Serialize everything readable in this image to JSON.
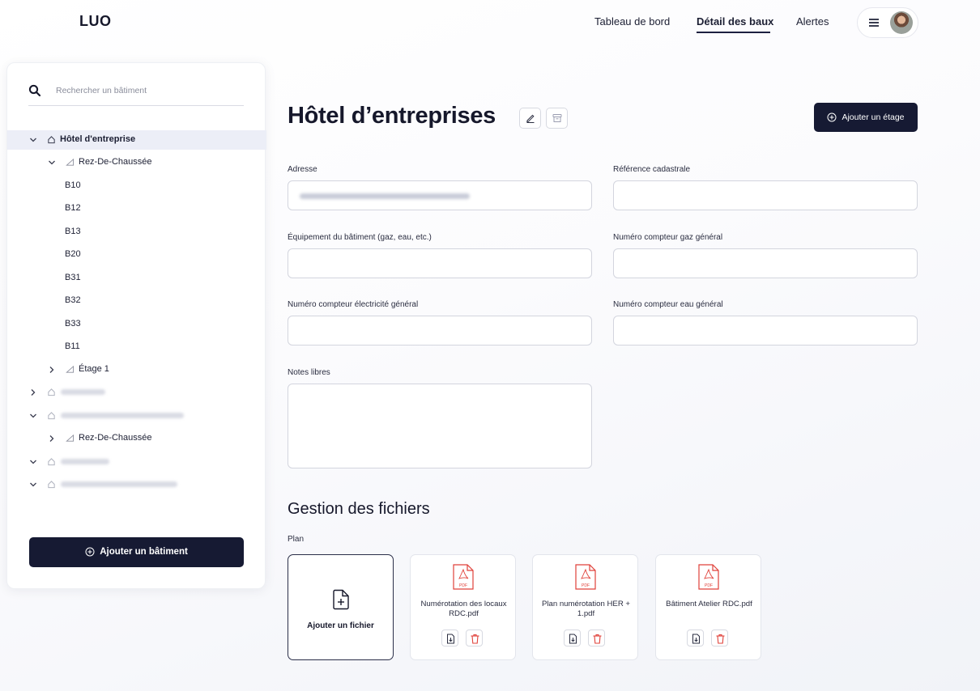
{
  "app": {
    "logo": "LUO"
  },
  "nav": [
    {
      "label": "Tableau de bord",
      "active": false
    },
    {
      "label": "Détail des baux",
      "active": true
    },
    {
      "label": "Alertes",
      "active": false
    }
  ],
  "sidebar": {
    "search_placeholder": "Rechercher un bâtiment",
    "tree": {
      "building": "Hôtel d'entreprise",
      "floor_rdc": "Rez-De-Chaussée",
      "units": [
        "B10",
        "B12",
        "B13",
        "B20",
        "B31",
        "B32",
        "B33",
        "B11"
      ],
      "floor_1": "Étage 1",
      "floor_rdc_2": "Rez-De-Chaussée"
    },
    "add_building_label": "Ajouter un bâtiment"
  },
  "main": {
    "title": "Hôtel d’entreprises",
    "add_floor_label": "Ajouter un étage",
    "fields": {
      "address_label": "Adresse",
      "cadastral_label": "Référence cadastrale",
      "equipment_label": "Équipement du bâtiment (gaz, eau, etc.)",
      "gas_meter_label": "Numéro compteur gaz général",
      "electricity_meter_label": "Numéro compteur électricité général",
      "water_meter_label": "Numéro compteur eau général",
      "notes_label": "Notes libres"
    },
    "files": {
      "section_title": "Gestion des fichiers",
      "plan_label": "Plan",
      "upload_label": "Ajouter un fichier",
      "items": [
        {
          "name": "Numérotation des locaux RDC.pdf"
        },
        {
          "name": "Plan numérotation HER + 1.pdf"
        },
        {
          "name": "Bâtiment Atelier RDC.pdf"
        }
      ]
    }
  },
  "colors": {
    "primary_dark": "#161a33",
    "danger": "#e0413a",
    "selected_row": "#eceef7"
  }
}
